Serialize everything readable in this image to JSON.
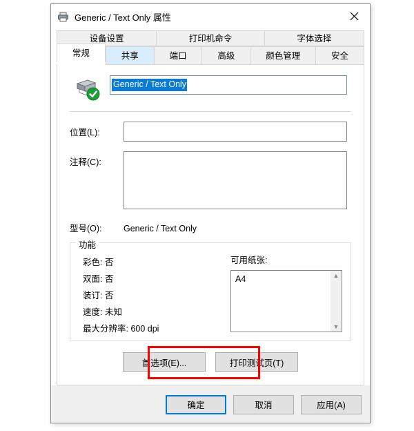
{
  "window": {
    "title": "Generic / Text Only 属性",
    "title_icon": "printer-icon",
    "close_icon": "close-icon"
  },
  "tabs": {
    "top_row": [
      {
        "label": "设备设置",
        "state": "normal"
      },
      {
        "label": "打印机命令",
        "state": "normal"
      },
      {
        "label": "字体选择",
        "state": "normal"
      }
    ],
    "bottom_row": [
      {
        "label": "常规",
        "state": "selected"
      },
      {
        "label": "共享",
        "state": "hover"
      },
      {
        "label": "端口",
        "state": "normal"
      },
      {
        "label": "高级",
        "state": "normal"
      },
      {
        "label": "颜色管理",
        "state": "normal"
      },
      {
        "label": "安全",
        "state": "normal"
      }
    ]
  },
  "general_tab": {
    "printer_icon": "printer-ready-icon",
    "printer_name_value": "Generic / Text Only",
    "location": {
      "label": "位置(L):",
      "value": "",
      "placeholder": ""
    },
    "comment": {
      "label": "注释(C):",
      "value": "",
      "placeholder": ""
    },
    "model": {
      "label": "型号(O):",
      "value": "Generic / Text Only"
    },
    "features": {
      "legend": "功能",
      "items": [
        "彩色: 否",
        "双面: 否",
        "装订: 否",
        "速度: 未知",
        "最大分辨率: 600 dpi"
      ],
      "paper_label": "可用纸张:",
      "paper_items": [
        "A4"
      ],
      "scroll_up_icon": "chevron-up-icon",
      "scroll_down_icon": "chevron-down-icon"
    },
    "actions": {
      "preferences_label": "首选项(E)...",
      "test_page_label": "打印测试页(T)"
    }
  },
  "footer": {
    "ok_label": "确定",
    "cancel_label": "取消",
    "apply_label": "应用(A)"
  },
  "annotation": {
    "color": "#ff0000",
    "target": "preferences-button"
  },
  "colors": {
    "selection_blue": "#0b7ad4",
    "tab_hover_blue": "#d8ecfb",
    "default_button_border": "#0078d7",
    "annotation_red": "#ff0000",
    "status_green": "#1e9e36"
  }
}
